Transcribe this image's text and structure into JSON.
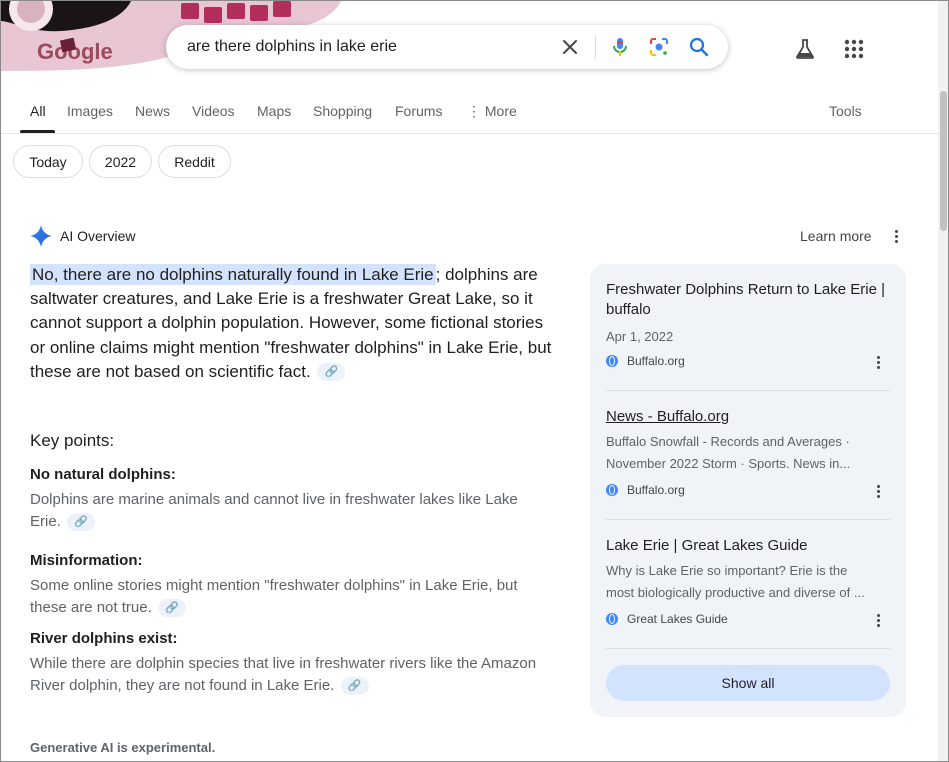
{
  "header": {
    "logo_text": "Google",
    "search_query": "are there dolphins in lake erie",
    "icons": [
      "close-icon",
      "mic-icon",
      "lens-icon",
      "search-icon",
      "labs-icon",
      "apps-icon"
    ]
  },
  "tabs": [
    {
      "label": "All",
      "active": true
    },
    {
      "label": "Images"
    },
    {
      "label": "News"
    },
    {
      "label": "Videos"
    },
    {
      "label": "Maps"
    },
    {
      "label": "Shopping"
    },
    {
      "label": "Forums"
    },
    {
      "label": "More"
    },
    {
      "label": "Tools"
    }
  ],
  "chips": [
    "Today",
    "2022",
    "Reddit"
  ],
  "ai_overview": {
    "title": "AI Overview",
    "learn_more": "Learn more",
    "lead_highlight": "No, there are no dolphins naturally found in Lake Erie",
    "lead_rest": "; dolphins are saltwater creatures, and Lake Erie is a freshwater Great Lake, so it cannot support a dolphin population. However, some fictional stories or online claims might mention \"freshwater dolphins\" in Lake Erie, but these are not based on scientific fact.",
    "key_points_title": "Key points:",
    "points": [
      {
        "head": "No natural dolphins:",
        "body": "Dolphins are marine animals and cannot live in freshwater lakes like Lake Erie."
      },
      {
        "head": "Misinformation:",
        "body": "Some online stories might mention \"freshwater dolphins\" in Lake Erie, but these are not true."
      },
      {
        "head": "River dolphins exist:",
        "body": "While there are dolphin species that live in freshwater rivers like the Amazon River dolphin, they are not found in Lake Erie."
      }
    ],
    "footer": "Generative AI is experimental."
  },
  "sources": [
    {
      "title": "Freshwater Dolphins Return to Lake Erie | buffalo",
      "date": "Apr 1, 2022",
      "site": "Buffalo.org"
    },
    {
      "title": "News - Buffalo.org",
      "desc1": "Buffalo Snowfall - Records and Averages ·",
      "desc2": "November 2022 Storm · Sports. News in...",
      "site": "Buffalo.org"
    },
    {
      "title": "Lake Erie | Great Lakes Guide",
      "desc1": "Why is Lake Erie so important? Erie is the",
      "desc2": "most biologically productive and diverse of ...",
      "site": "Great Lakes Guide"
    }
  ],
  "show_all": "Show all",
  "colors": {
    "accent_blue": "#1a73e8",
    "highlight": "#d3e3fd",
    "panel": "#f0f4f9"
  }
}
